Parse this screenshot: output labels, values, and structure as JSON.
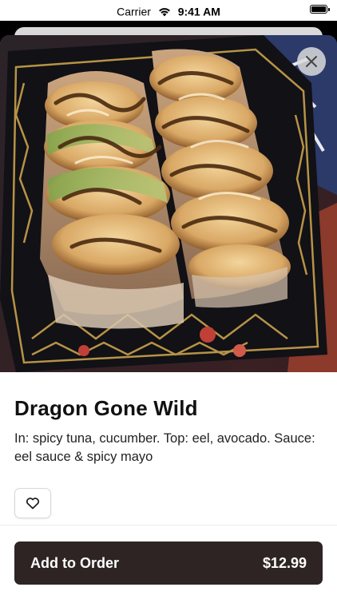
{
  "status_bar": {
    "carrier": "Carrier",
    "time": "9:41 AM"
  },
  "item": {
    "image_alt": "Dragon Gone Wild sushi roll in a black takeout tray",
    "title": "Dragon Gone Wild",
    "description": "In: spicy tuna, cucumber. Top: eel, avocado. Sauce: eel sauce & spicy mayo"
  },
  "icons": {
    "close": "close-icon",
    "favorite": "heart-outline-icon"
  },
  "order": {
    "button_label": "Add to Order",
    "price": "$12.99"
  },
  "colors": {
    "button_bg": "#2f2424",
    "sheet_bg": "#ffffff"
  }
}
